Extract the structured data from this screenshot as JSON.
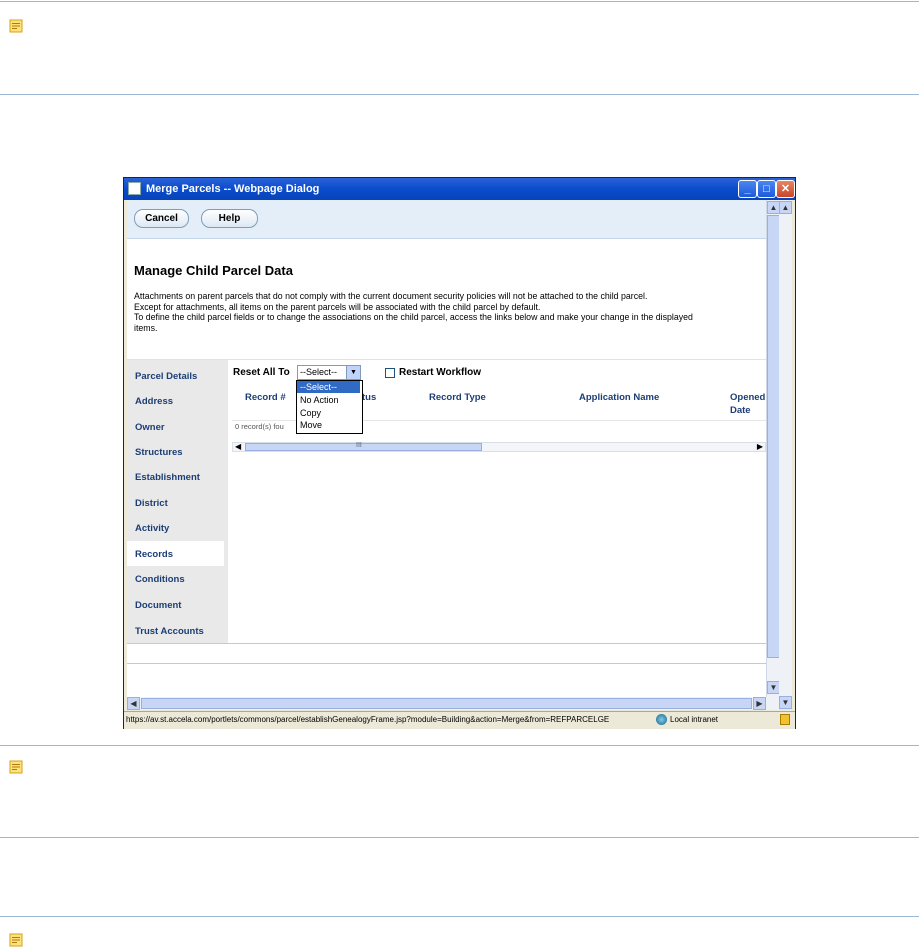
{
  "dialog": {
    "title": "Merge Parcels  -- Webpage Dialog",
    "controls": {
      "minimize": "_",
      "maximize": "□",
      "close": "✕"
    },
    "toolbar": {
      "cancel": "Cancel",
      "help": "Help"
    },
    "heading": "Manage Child Parcel Data",
    "description": [
      "Attachments on parent parcels that do not comply with the current document security policies will not be attached to the child parcel.",
      "Except for attachments, all items on the parent parcels will be associated with the child parcel by default.",
      "To define the child parcel fields or to change the associations on the child parcel, access the links below and make your change in the displayed",
      "items."
    ],
    "sidebar": {
      "items": [
        "Parcel Details",
        "Address",
        "Owner",
        "Structures",
        "Establishment",
        "District",
        "Activity",
        "Records",
        "Conditions",
        "Document",
        "Trust Accounts"
      ],
      "active": "Records"
    },
    "reset_all_label": "Reset All To",
    "select_value": "--Select--",
    "dropdown_options": [
      "--Select--",
      "No Action",
      "Copy",
      "Move"
    ],
    "restart_workflow_label": "Restart Workflow",
    "columns": [
      "Record #",
      "Status",
      "Record Type",
      "Application Name",
      "Opened Date"
    ],
    "columns_visible": {
      "status_fragment": "tus",
      "opened_line1": "Opened",
      "opened_line2": "Date"
    },
    "records_footer": "0 record(s) found",
    "records_footer_visible": "0 record(s) fou",
    "scroll_grip": "III",
    "status_url": "https://av.st.accela.com/portlets/commons/parcel/establishGenealogyFrame.jsp?module=Building&action=Merge&from=REFPARCELGE",
    "zone": "Local intranet"
  }
}
